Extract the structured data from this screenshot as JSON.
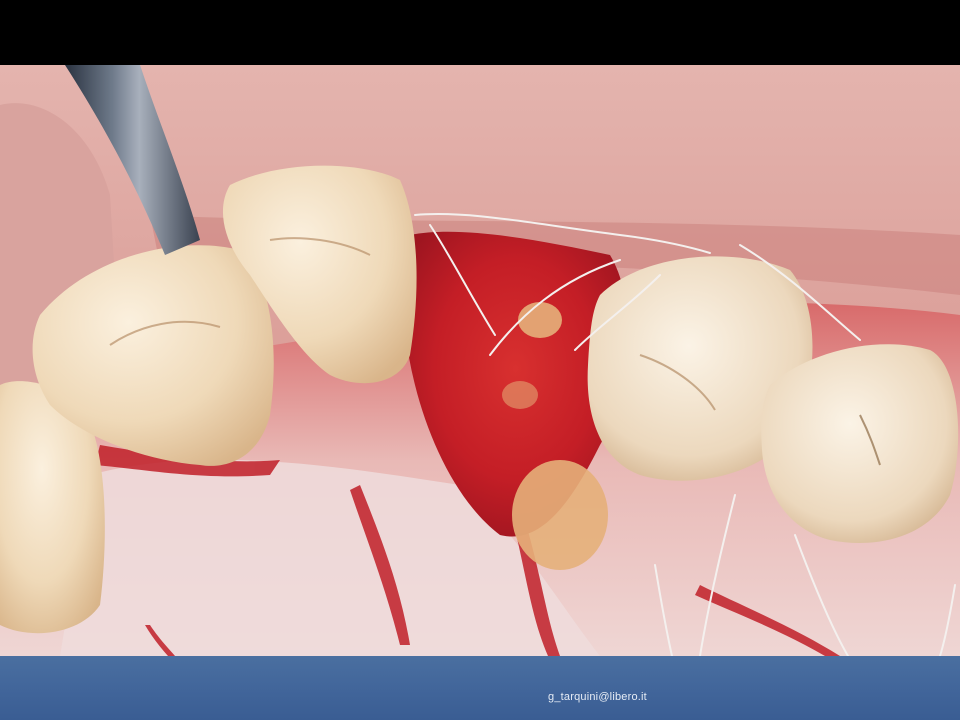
{
  "footer": {
    "credit_text": "g_tarquini@libero.it"
  },
  "colors": {
    "background": "#000000",
    "footer_band": "#41659a",
    "footer_text": "#e6ecf5",
    "tissue_red": "#c0202a",
    "gingiva_pink": "#d9a0a0",
    "tooth_enamel": "#f0dcc0"
  },
  "photo": {
    "subject": "intraoral surgical view with sutures"
  }
}
